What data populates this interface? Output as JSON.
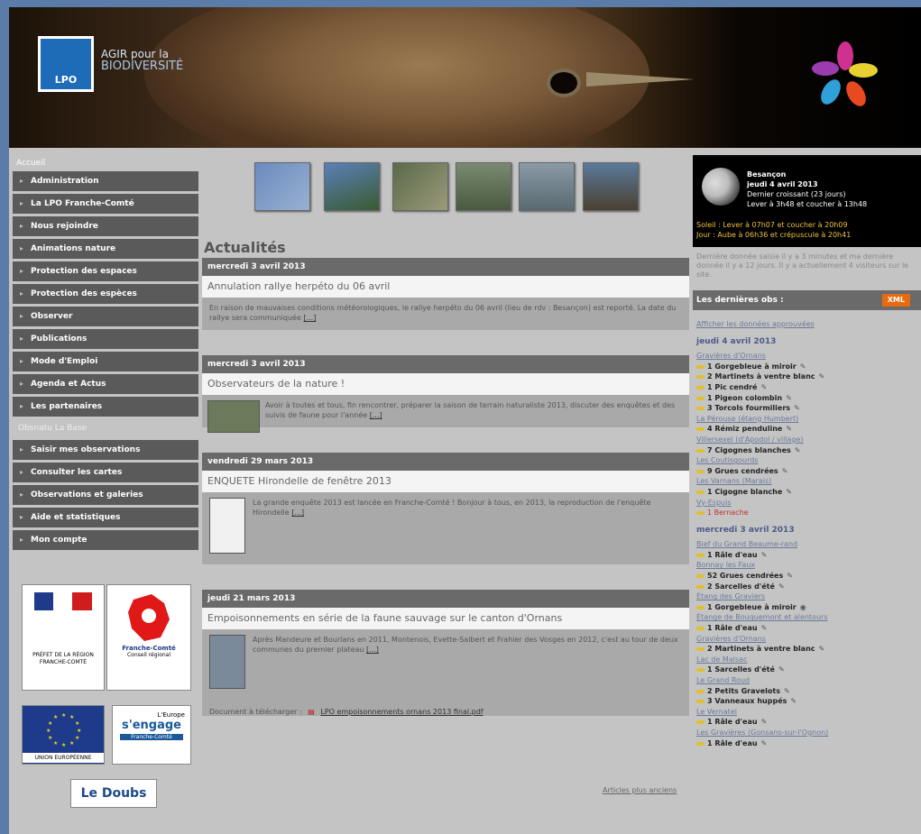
{
  "banner": {
    "lpo_label": "LPO",
    "agir_line1": "AGIR pour la",
    "agir_line2": "BIODIVERSITÉ"
  },
  "nav": {
    "home": "Accueil",
    "items": [
      "Administration",
      "La LPO Franche-Comté",
      "Nous rejoindre",
      "Animations nature",
      "Protection des espaces",
      "Protection des espèces",
      "Observer",
      "Publications",
      "Mode d'Emploi",
      "Agenda et Actus",
      "Les partenaires"
    ],
    "section": "Obsnatu La Base",
    "items2": [
      "Saisir mes observations",
      "Consulter les cartes",
      "Observations et galeries",
      "Aide et statistiques",
      "Mon compte"
    ]
  },
  "partners": {
    "prefet": "PRÉFET DE LA RÉGION FRANCHE-COMTÉ",
    "fc": "Franche-Comté",
    "fc_sub": "Conseil régional",
    "ue": "UNION EUROPÉENNE",
    "engage": "s'engage",
    "engage_top": "L'Europe",
    "engage_sub": "Franche-Comté",
    "doubs": "Le Doubs"
  },
  "center": {
    "heading": "Actualités",
    "older": "Articles plus anciens",
    "more": "[...]",
    "articles": [
      {
        "date": "mercredi 3 avril 2013",
        "title": "Annulation rallye herpéto du 06 avril",
        "body": "En raison de mauvaises conditions météorologiques, le rallye herpéto du 06 avril (lieu de rdv : Besançon) est reporté. La date du rallye sera communiquée"
      },
      {
        "date": "mercredi 3 avril 2013",
        "title": "Observateurs de la nature !",
        "body": "Avoir à toutes et tous, fin rencontrer, préparer la saison de terrain naturaliste 2013, discuter des enquêtes et des suivis de faune pour l'année"
      },
      {
        "date": "vendredi 29 mars 2013",
        "title": "ENQUETE Hirondelle de fenêtre 2013",
        "body": "La grande enquête 2013 est lancée en Franche-Comté ! Bonjour à tous, en 2013, la reproduction de l'enquête Hirondelle"
      },
      {
        "date": "jeudi 21 mars 2013",
        "title": "Empoisonnements en série de la faune sauvage sur le canton d'Ornans",
        "body": "Après Mandeure et Bourlans en 2011, Montenois, Evette-Salbert et Frahier des Vosges en 2012, c'est au tour de deux communes du premier plateau",
        "download_label": "Document à télécharger :",
        "download_file": "LPO empoisonnements ornans 2013 final.pdf"
      }
    ]
  },
  "right": {
    "moon": {
      "city": "Besançon",
      "date": "jeudi 4 avril 2013",
      "phase": "Dernier croissant (23 jours)",
      "rise": "Lever à 3h48 et coucher à 13h48",
      "sun": "Soleil : Lever à 07h07 et coucher à 20h09",
      "day": "Jour : Aube à 06h36 et crépuscule à 20h41"
    },
    "seen": "Dernière donnée saisie il y a 3 minutes et ma dernière donnée il y a 12 jours. Il y a actuellement 4 visiteurs sur le site.",
    "last_title": "Les dernières obs :",
    "xml": "XML",
    "filter_link": "Afficher les données approuvées",
    "days": [
      {
        "date": "jeudi 4 avril 2013",
        "groups": [
          {
            "place": "Gravières d'Ornans",
            "obs": [
              "1 Gorgebleue à miroir",
              "2 Martinets à ventre blanc",
              "1 Pic cendré",
              "1 Pigeon colombin",
              "3 Torcols fourmiliers"
            ]
          },
          {
            "place": "La Pérouse (étang Humbert)",
            "obs": [
              "4 Rémiz penduline"
            ]
          },
          {
            "place": "Villersexel (d'Apodol / village)",
            "obs": [
              "7 Cigognes blanches"
            ]
          },
          {
            "place": "Les Coutisgourds",
            "obs": [
              "9 Grues cendrées"
            ]
          },
          {
            "place": "Les Varnans (Marais)",
            "obs": [
              "1 Cigogne blanche"
            ]
          },
          {
            "place": "Vy-Espuis",
            "obs": [
              "1 Bernache"
            ]
          }
        ]
      },
      {
        "date": "mercredi 3 avril 2013",
        "groups": [
          {
            "place": "Bief du Grand Beaume-rand",
            "obs": [
              "1 Râle d'eau"
            ]
          },
          {
            "place": "Bonnay les Faux",
            "obs": [
              "52 Grues cendrées",
              "2 Sarcelles d'été"
            ]
          },
          {
            "place": "Étang des Graviers",
            "obs": [
              "1 Gorgebleue à miroir"
            ]
          },
          {
            "place": "Étange de Bouquemont et alentours",
            "obs": [
              "1 Râle d'eau"
            ]
          },
          {
            "place": "Gravières d'Ornans",
            "obs": [
              "2 Martinets à ventre blanc"
            ]
          },
          {
            "place": "Lac de Malsac",
            "obs": [
              "1 Sarcelles d'été"
            ]
          },
          {
            "place": "Le Grand Roud",
            "obs": [
              "2 Petits Gravelots",
              "3 Vanneaux huppés"
            ]
          },
          {
            "place": "Le Vernatel",
            "obs": [
              "1 Râle d'eau"
            ]
          },
          {
            "place": "Les Gravières (Gonsans-sur-l'Ognon)",
            "obs": [
              "1 Râle d'eau"
            ]
          }
        ]
      }
    ]
  }
}
